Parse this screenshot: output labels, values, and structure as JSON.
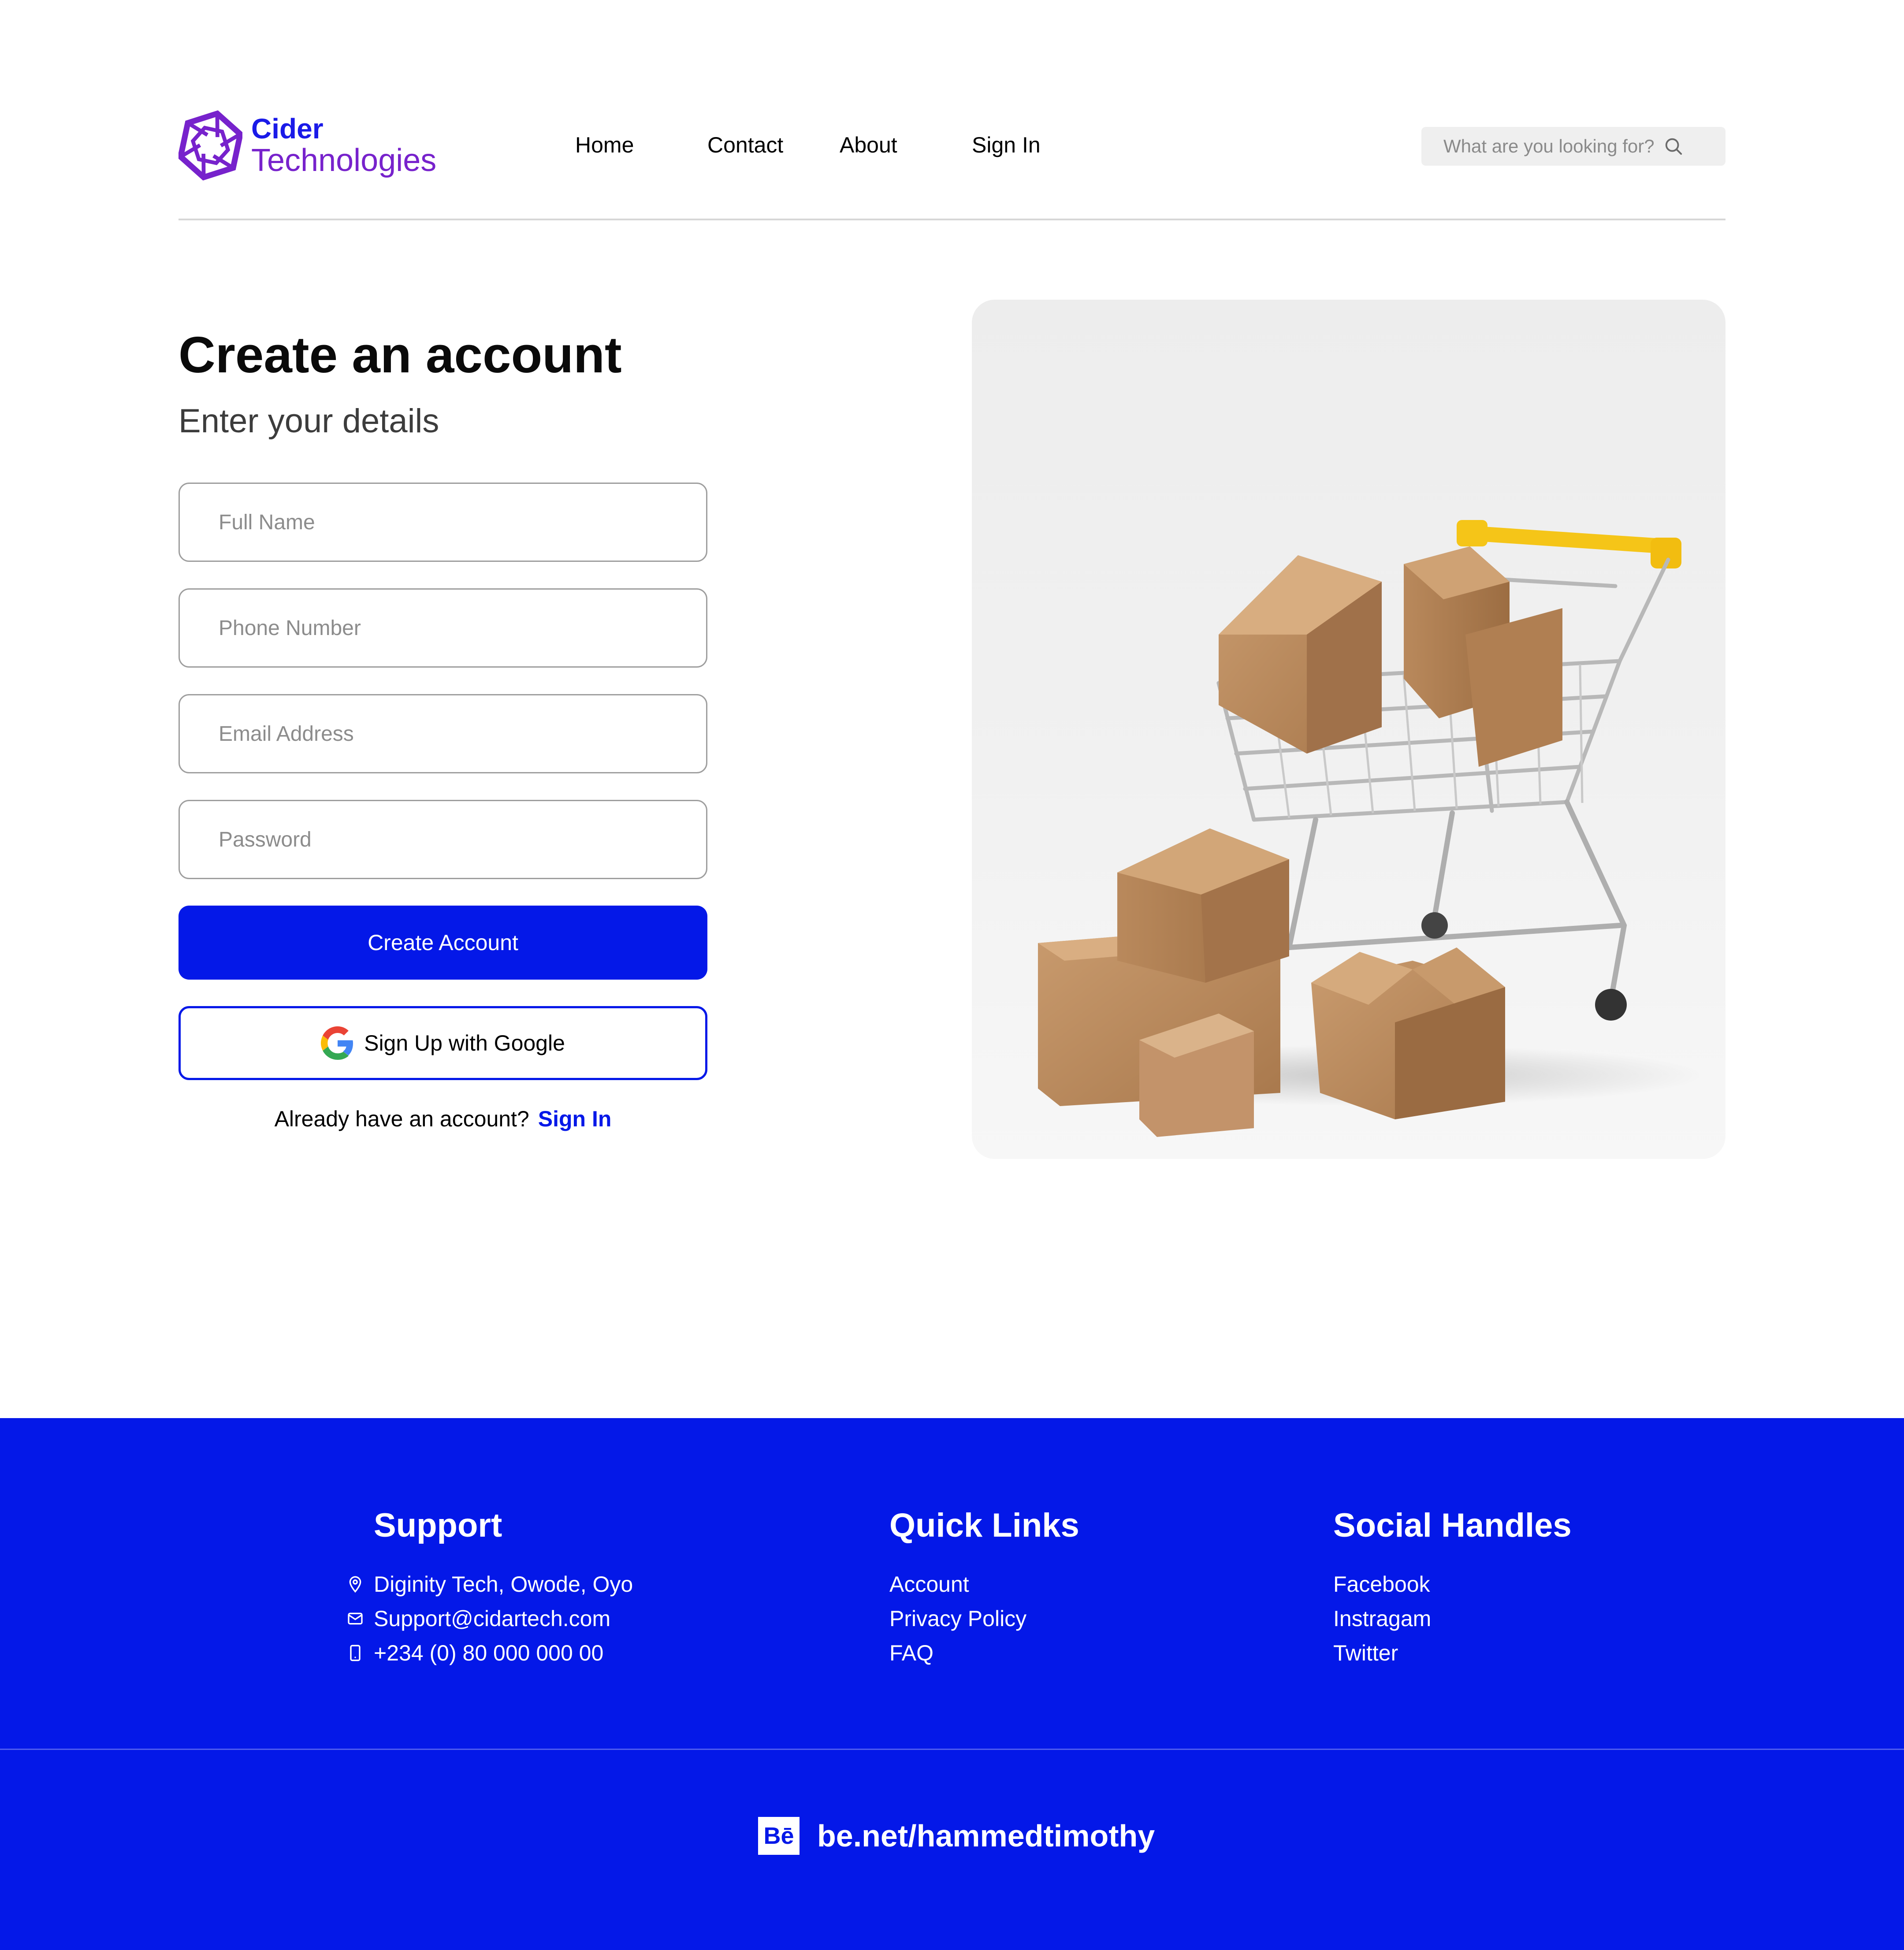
{
  "brand": {
    "line1": "Cider",
    "line2": "Technologies",
    "color_primary": "#1a1ae8",
    "color_secondary": "#7722cc"
  },
  "nav": {
    "home": "Home",
    "contact": "Contact",
    "about": "About",
    "sign_in": "Sign In"
  },
  "search": {
    "placeholder": "What are you looking for?",
    "icon": "search-icon"
  },
  "form": {
    "title": "Create an account",
    "subtitle": "Enter your details",
    "full_name_placeholder": "Full Name",
    "phone_placeholder": "Phone Number",
    "email_placeholder": "Email Address",
    "password_placeholder": "Password",
    "create_button": "Create Account",
    "google_button": "Sign Up with Google",
    "have_account_text": "Already have an account?",
    "sign_in_link": "Sign In"
  },
  "hero": {
    "image": "shopping-cart-with-boxes"
  },
  "footer": {
    "support": {
      "heading": "Support",
      "address": "Diginity Tech, Owode, Oyo",
      "email": "Support@cidartech.com",
      "phone": "+234 (0) 80 000 000 00"
    },
    "quick_links": {
      "heading": "Quick Links",
      "items": [
        "Account",
        "Privacy Policy",
        "FAQ"
      ]
    },
    "social": {
      "heading": "Social Handles",
      "items": [
        "Facebook",
        "Instragam",
        "Twitter"
      ]
    },
    "behance": {
      "logo": "Bē",
      "url": "be.net/hammedtimothy"
    }
  },
  "colors": {
    "accent": "#0418e8",
    "footer_bg": "#0418e8"
  }
}
